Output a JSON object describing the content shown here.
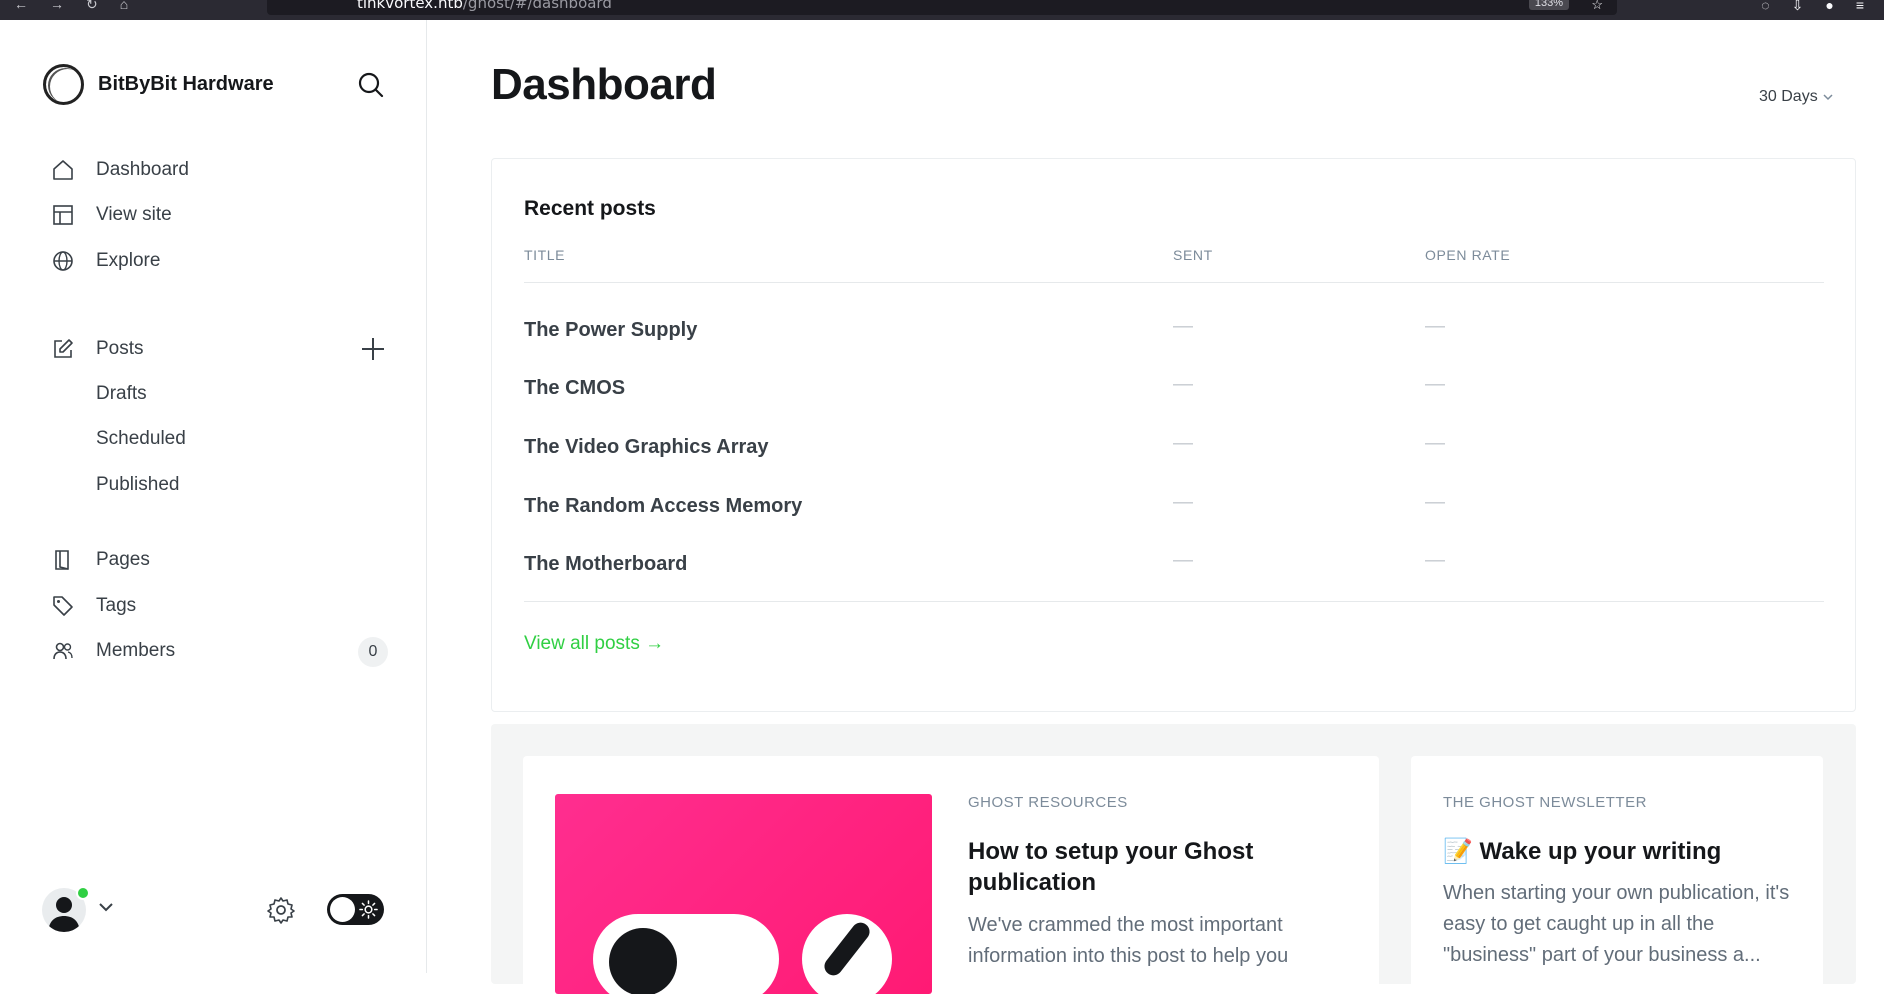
{
  "browser": {
    "url_host": "tinkvortex.htb",
    "url_path": "/ghost/#/dashboard",
    "zoom": "133%"
  },
  "sidebar": {
    "site_name": "BitByBit Hardware",
    "nav": {
      "dashboard": "Dashboard",
      "view_site": "View site",
      "explore": "Explore",
      "posts": "Posts",
      "drafts": "Drafts",
      "scheduled": "Scheduled",
      "published": "Published",
      "pages": "Pages",
      "tags": "Tags",
      "members": "Members",
      "members_count": "0"
    }
  },
  "main": {
    "title": "Dashboard",
    "range": "30 Days",
    "recent_posts": {
      "title": "Recent posts",
      "columns": {
        "title": "TITLE",
        "sent": "SENT",
        "open_rate": "OPEN RATE"
      },
      "rows": [
        {
          "title": "The Power Supply",
          "sent": "—",
          "open_rate": "—"
        },
        {
          "title": "The CMOS",
          "sent": "—",
          "open_rate": "—"
        },
        {
          "title": "The Video Graphics Array",
          "sent": "—",
          "open_rate": "—"
        },
        {
          "title": "The Random Access Memory",
          "sent": "—",
          "open_rate": "—"
        },
        {
          "title": "The Motherboard",
          "sent": "—",
          "open_rate": "—"
        }
      ],
      "view_all": "View all posts →"
    },
    "resources": {
      "eyebrow": "GHOST RESOURCES",
      "title": "How to setup your Ghost publication",
      "excerpt": "We've crammed the most important information into this post to help you"
    },
    "newsletter": {
      "eyebrow": "THE GHOST NEWSLETTER",
      "title": "📝 Wake up your writing",
      "excerpt": "When starting your own publication, it's easy to get caught up in all the \"business\" part of your business a..."
    }
  },
  "colors": {
    "accent": "#30cf43",
    "text": "#15171a",
    "muted": "#7c8b9a",
    "hero_pink": "#ff1a74"
  }
}
